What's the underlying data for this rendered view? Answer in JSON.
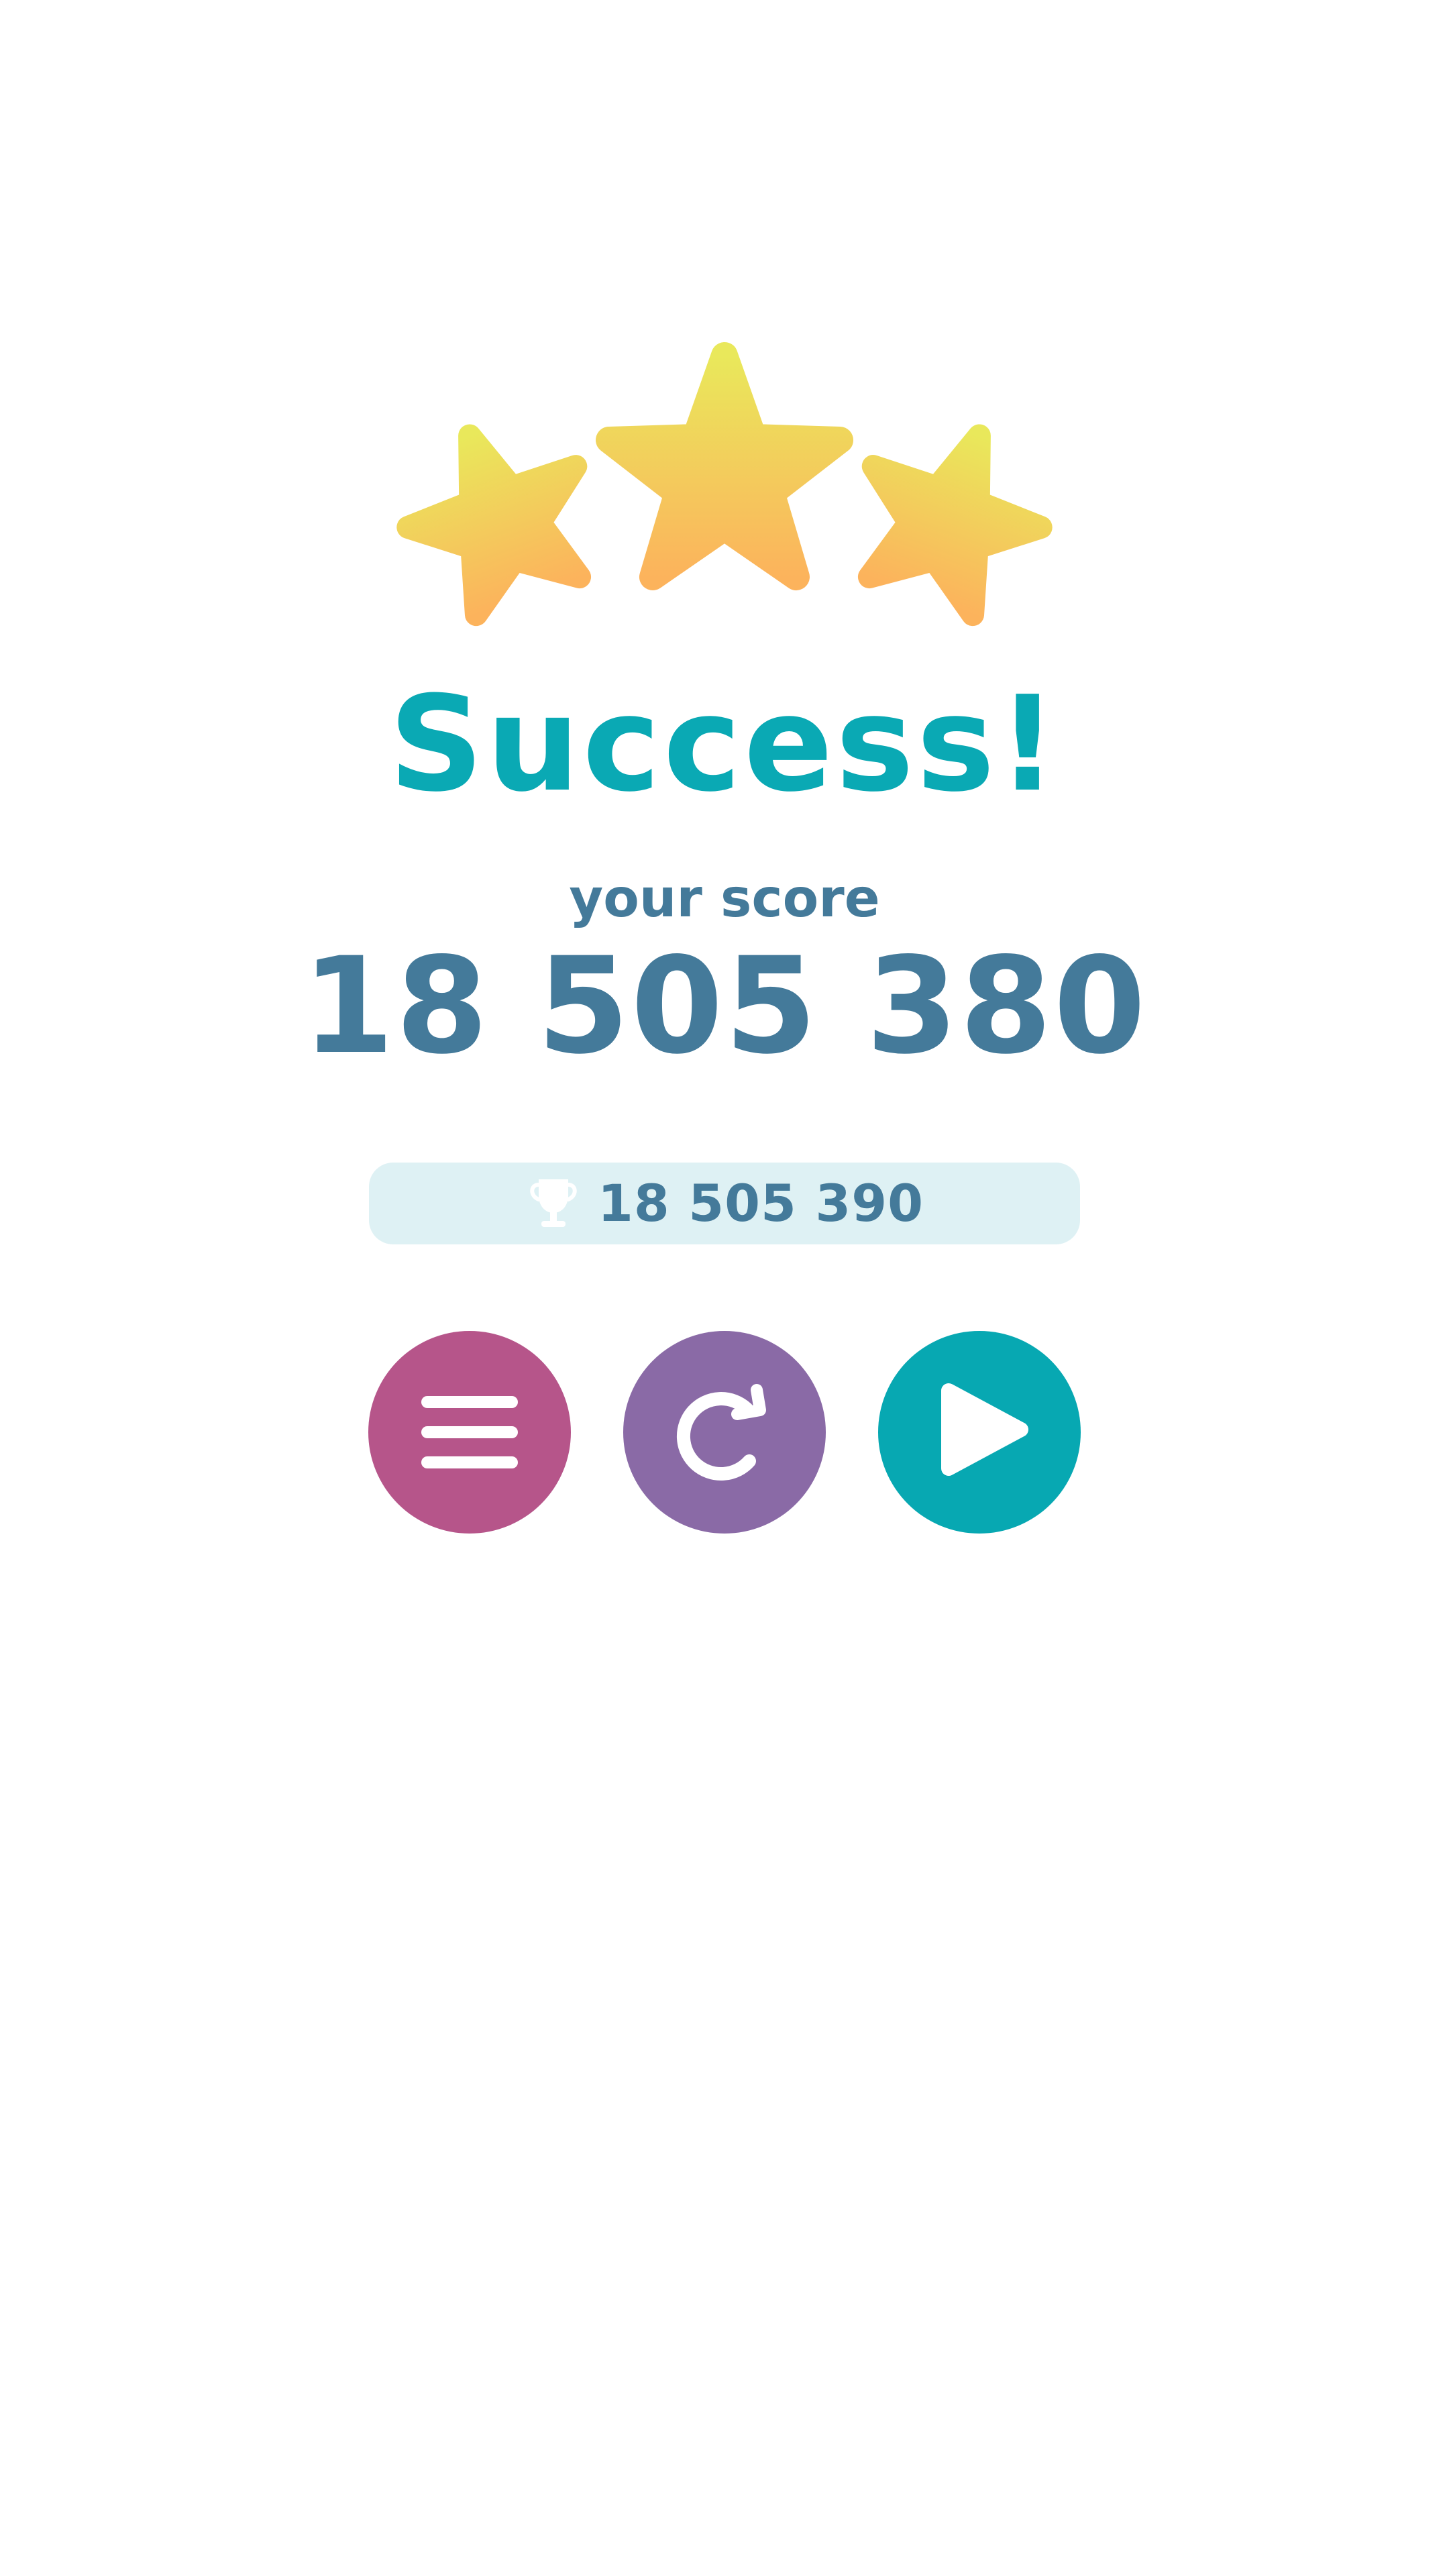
{
  "result": {
    "title": "Success!",
    "stars_earned": 3,
    "stars_total": 3
  },
  "score": {
    "label": "your score",
    "value": "18 505 380"
  },
  "best": {
    "icon": "trophy-icon",
    "value": "18 505 390"
  },
  "buttons": {
    "menu": {
      "icon": "menu-icon"
    },
    "restart": {
      "icon": "restart-icon"
    },
    "next": {
      "icon": "play-icon"
    }
  },
  "colors": {
    "accent": "#0aa9b4",
    "text": "#447a9a",
    "best_panel_bg": "#def1f4",
    "menu_button": "#b6558a",
    "restart_button": "#8a6aa6",
    "next_button": "#07a8b2",
    "star_top": "#e9e85b",
    "star_bottom": "#fcb35c"
  }
}
